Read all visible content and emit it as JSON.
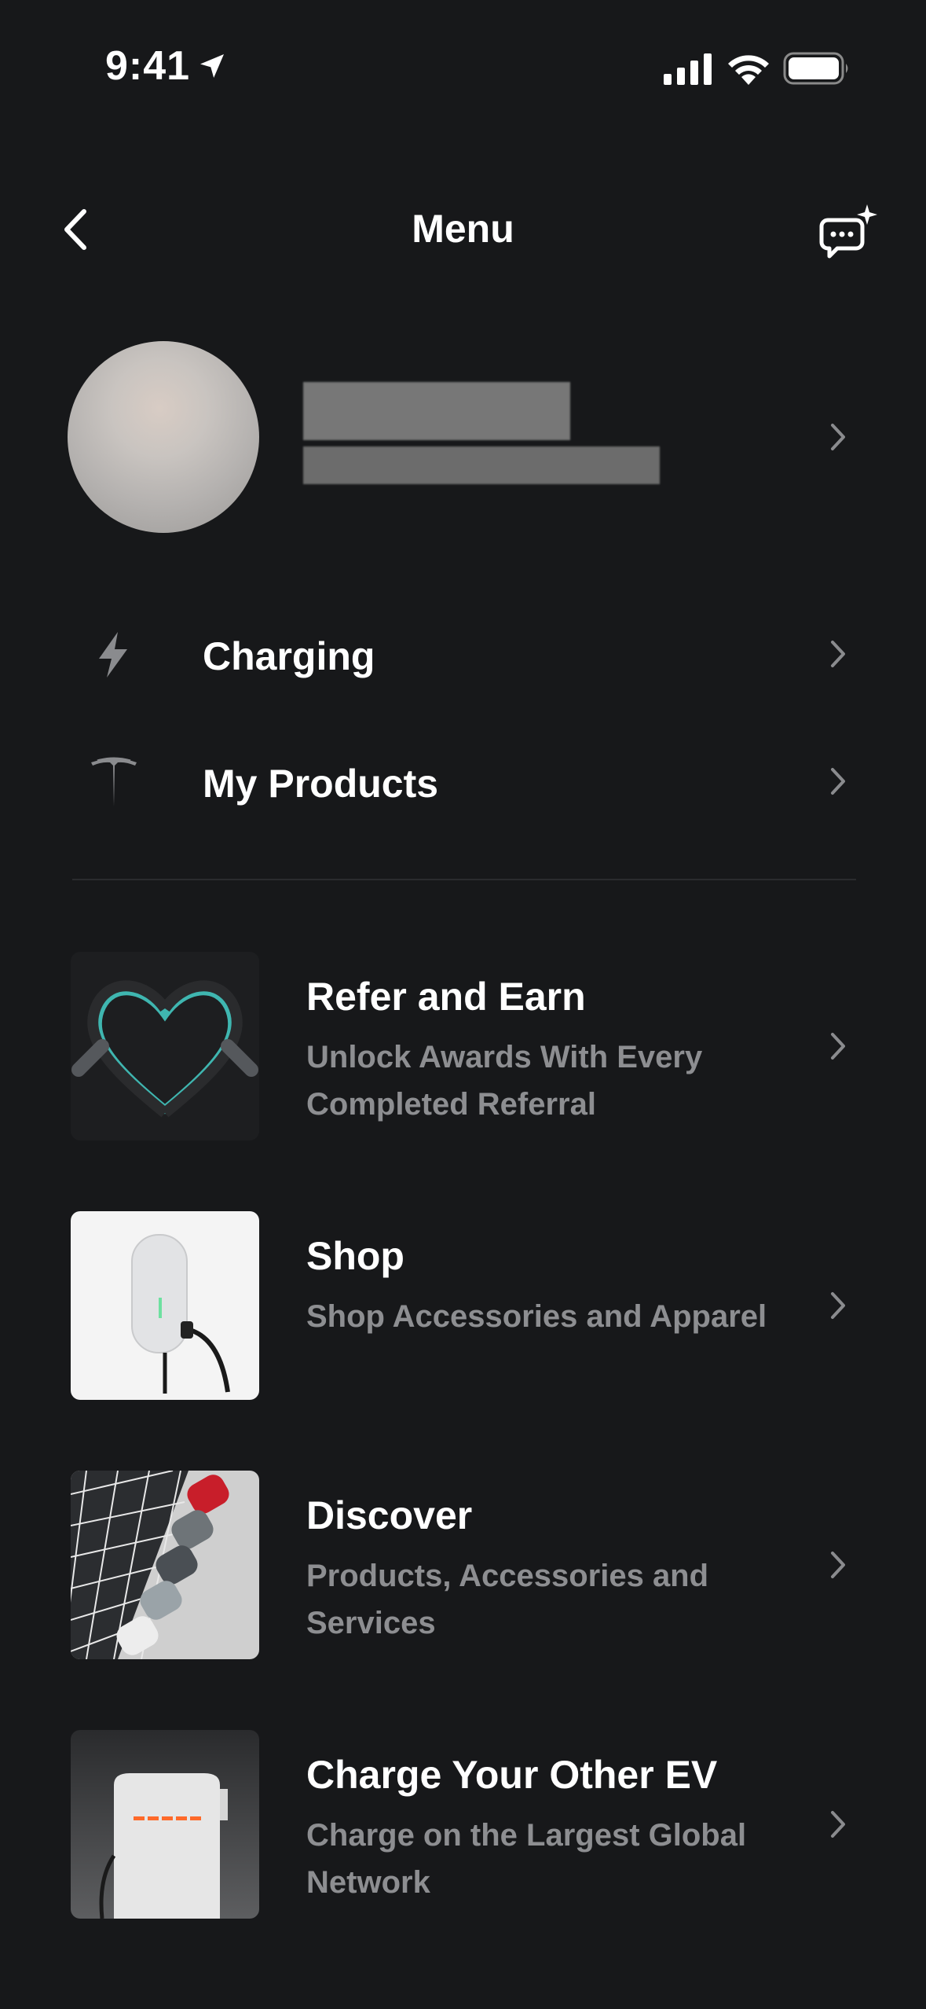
{
  "status_bar": {
    "time": "9:41"
  },
  "header": {
    "title": "Menu"
  },
  "menu_rows": [
    {
      "label": "Charging",
      "icon": "bolt-icon"
    },
    {
      "label": "My Products",
      "icon": "tesla-logo-icon"
    }
  ],
  "cards": [
    {
      "title": "Refer and Earn",
      "subtitle": "Unlock Awards With Every Completed Referral"
    },
    {
      "title": "Shop",
      "subtitle": "Shop Accessories and Apparel"
    },
    {
      "title": "Discover",
      "subtitle": "Products, Accessories and Services"
    },
    {
      "title": "Charge Your Other EV",
      "subtitle": "Charge on the Largest Global Network"
    }
  ],
  "colors": {
    "background": "#17181a",
    "subtitle": "#8d8e91",
    "icon": "#8a8b8e"
  }
}
